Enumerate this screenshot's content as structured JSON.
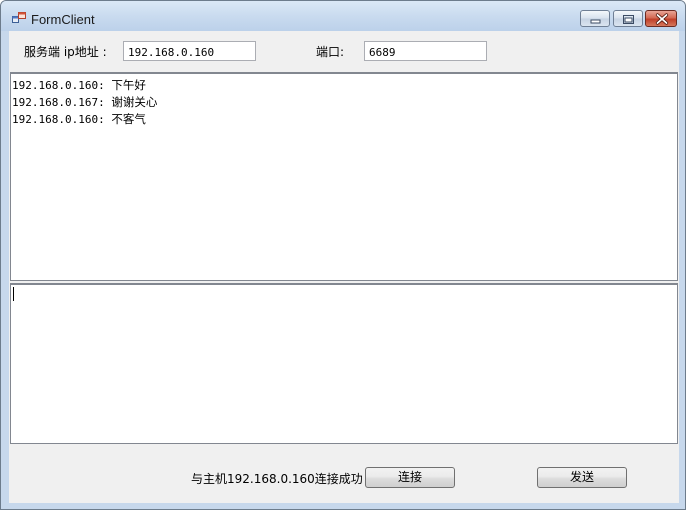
{
  "window": {
    "title": "FormClient"
  },
  "server": {
    "ip_label": "服务端 ip地址 :",
    "ip_value": "192.168.0.160",
    "port_label": "端口:",
    "port_value": "6689"
  },
  "chat": {
    "messages": [
      {
        "sender": "192.168.0.160:",
        "text": "下午好"
      },
      {
        "sender": "192.168.0.167:",
        "text": "谢谢关心"
      },
      {
        "sender": "192.168.0.160:",
        "text": "不客气"
      }
    ]
  },
  "compose": {
    "value": ""
  },
  "footer": {
    "status": "与主机192.168.0.160连接成功",
    "connect_label": "连接",
    "send_label": "发送"
  }
}
